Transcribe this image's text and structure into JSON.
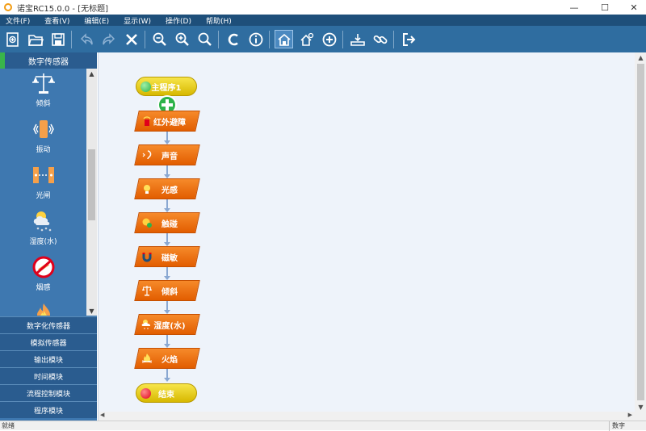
{
  "window": {
    "title": "诺宝RC15.0.0 - [无标题]",
    "min_glyph": "—",
    "max_glyph": "☐",
    "close_glyph": "✕"
  },
  "menu": [
    "文件(F)",
    "查看(V)",
    "编辑(E)",
    "显示(W)",
    "操作(D)",
    "帮助(H)"
  ],
  "toolbar": {
    "buttons": [
      "new-file-icon",
      "open-folder-icon",
      "save-icon",
      "undo-icon",
      "redo-icon",
      "delete-icon",
      "zoom-out-icon",
      "zoom-in-icon",
      "zoom-fit-icon",
      "c-compile-icon",
      "info-icon",
      "home-icon",
      "settings-home-icon",
      "add-circle-icon",
      "download-icon",
      "link-icon",
      "exit-icon"
    ]
  },
  "sidebar": {
    "active_category": "数字传感器",
    "sensors": [
      {
        "label": "倾斜",
        "icon": "tilt-icon"
      },
      {
        "label": "振动",
        "icon": "vibration-icon"
      },
      {
        "label": "光闸",
        "icon": "light-gate-icon"
      },
      {
        "label": "湿度(水)",
        "icon": "humidity-icon"
      },
      {
        "label": "烟感",
        "icon": "smoke-icon"
      },
      {
        "label": "",
        "icon": "flame-icon"
      }
    ],
    "categories": [
      "数字化传感器",
      "模拟传感器",
      "输出模块",
      "时间模块",
      "流程控制模块",
      "程序模块"
    ],
    "scroll_up": "▲",
    "scroll_down": "▼"
  },
  "flow": {
    "start": "主程序1",
    "blocks": [
      {
        "label": "红外避障",
        "icon": "infrared-icon"
      },
      {
        "label": "声音",
        "icon": "sound-icon"
      },
      {
        "label": "光感",
        "icon": "light-icon"
      },
      {
        "label": "触碰",
        "icon": "touch-icon"
      },
      {
        "label": "磁敏",
        "icon": "magnet-icon"
      },
      {
        "label": "倾斜",
        "icon": "tilt-icon"
      },
      {
        "label": "湿度(水)",
        "icon": "humidity-icon"
      },
      {
        "label": "火焰",
        "icon": "flame-icon"
      }
    ],
    "end": "结束",
    "start_color": "#2db34a",
    "end_color": "#e0001b"
  },
  "status": {
    "left": "就绪",
    "right": "数字"
  }
}
